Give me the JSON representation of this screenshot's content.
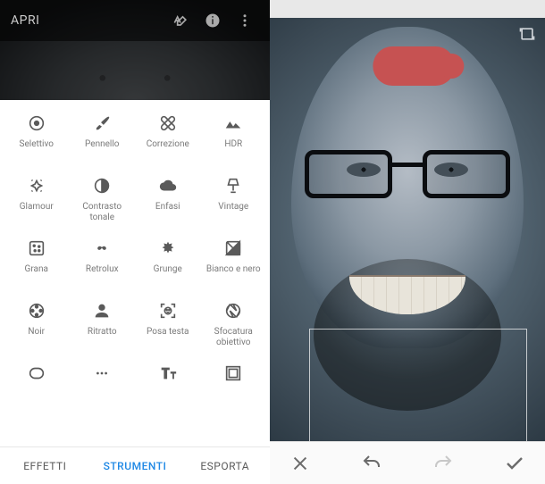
{
  "left": {
    "open_label": "APRI",
    "tabs": {
      "effects": "EFFETTI",
      "tools": "STRUMENTI",
      "export": "ESPORTA",
      "active": "tools"
    }
  },
  "tools": [
    {
      "id": "selective",
      "icon": "target",
      "label": "Selettivo"
    },
    {
      "id": "brush",
      "icon": "brush",
      "label": "Pennello"
    },
    {
      "id": "healing",
      "icon": "bandage",
      "label": "Correzione"
    },
    {
      "id": "hdr",
      "icon": "mountains",
      "label": "HDR"
    },
    {
      "id": "glamour",
      "icon": "sparkle",
      "label": "Glamour"
    },
    {
      "id": "tonal",
      "icon": "half-circle",
      "label": "Contrasto tonale"
    },
    {
      "id": "drama",
      "icon": "cloud",
      "label": "Enfasi"
    },
    {
      "id": "vintage",
      "icon": "lamp",
      "label": "Vintage"
    },
    {
      "id": "grain",
      "icon": "film-grain",
      "label": "Grana"
    },
    {
      "id": "retrolux",
      "icon": "mustache",
      "label": "Retrolux"
    },
    {
      "id": "grunge",
      "icon": "splat",
      "label": "Grunge"
    },
    {
      "id": "bw",
      "icon": "bw-square",
      "label": "Bianco e nero"
    },
    {
      "id": "noir",
      "icon": "film-reel",
      "label": "Noir"
    },
    {
      "id": "portrait",
      "icon": "person",
      "label": "Ritratto"
    },
    {
      "id": "headpose",
      "icon": "face-scan",
      "label": "Posa testa"
    },
    {
      "id": "lensblur",
      "icon": "aperture",
      "label": "Sfocatura obiettivo"
    },
    {
      "id": "vignette",
      "icon": "vignette",
      "label": ""
    },
    {
      "id": "unknown1",
      "icon": "dots",
      "label": ""
    },
    {
      "id": "text",
      "icon": "text-tt",
      "label": ""
    },
    {
      "id": "frames",
      "icon": "frame",
      "label": ""
    }
  ],
  "right": {
    "actions": {
      "cancel": "close",
      "undo": "undo",
      "redo": "redo",
      "apply": "check"
    },
    "redo_enabled": false,
    "healing_mark_color": "#c65252"
  }
}
